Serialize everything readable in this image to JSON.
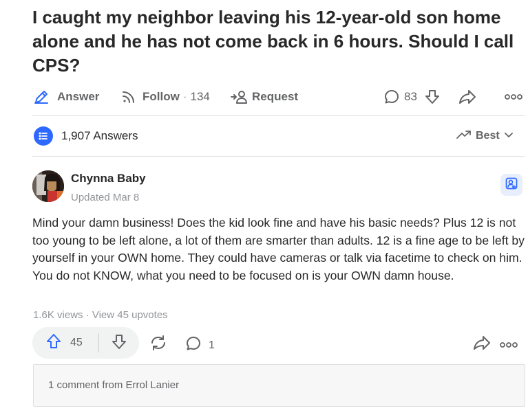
{
  "question": {
    "title": "I caught my neighbor leaving his 12-year-old son home alone and he has not come back in 6 hours. Should I call CPS?"
  },
  "actions": {
    "answer_label": "Answer",
    "follow_label": "Follow",
    "follow_separator": "·",
    "follow_count": "134",
    "request_label": "Request",
    "comment_count": "83",
    "icons": [
      "edit-icon",
      "follow-rss-icon",
      "request-person-icon",
      "comment-icon",
      "downvote-icon",
      "share-icon",
      "more-icon"
    ]
  },
  "answers_header": {
    "count_text": "1,907 Answers",
    "sort_label": "Best"
  },
  "answer": {
    "author_name": "Chynna Baby",
    "meta": "Updated Mar 8",
    "body": "Mind your damn business! Does the kid look fine and have his basic needs? Plus 12 is not too young to be left alone, a lot of them are smarter than adults. 12 is a fine age to be left by yourself in your OWN home. They could have cameras or talk via facetime to check on him. You do not KNOW, what you need to be focused on is your OWN damn house.",
    "stats": "1.6K views · View 45 upvotes",
    "upvotes": "45",
    "comments": "1",
    "comment_preview": "1 comment from Errol Lanier"
  },
  "colors": {
    "accent_blue": "#2e69ff",
    "text_primary": "#282829",
    "text_secondary": "#636466",
    "text_muted": "#939598"
  }
}
